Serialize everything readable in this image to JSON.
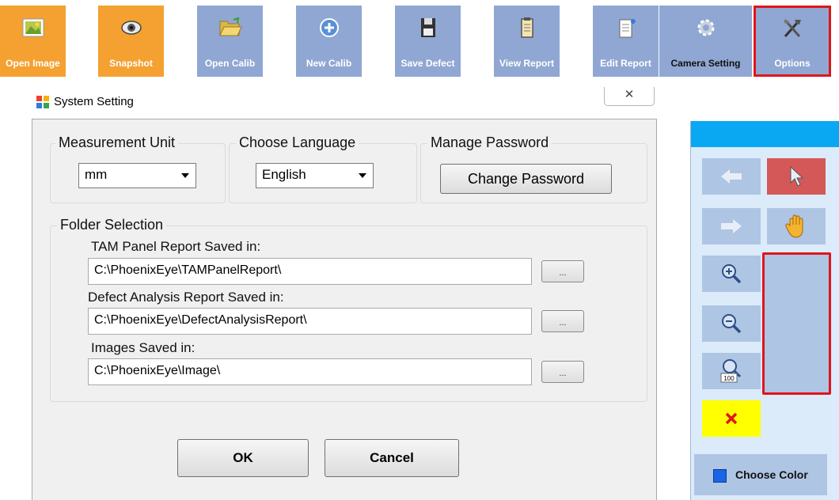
{
  "toolbar": {
    "buttons": [
      {
        "label": "Open Image",
        "icon": "image-icon"
      },
      {
        "label": "Snapshot",
        "icon": "eye-icon"
      },
      {
        "label": "Open Calib",
        "icon": "folder-open-icon"
      },
      {
        "label": "New Calib",
        "icon": "plus-circle-icon"
      },
      {
        "label": "Save Defect",
        "icon": "floppy-disk-icon"
      },
      {
        "label": "View Report",
        "icon": "clipboard-icon"
      },
      {
        "label": "Edit Report",
        "icon": "edit-document-icon"
      },
      {
        "label": "Camera Setting",
        "icon": "gear-icon"
      },
      {
        "label": "Options",
        "icon": "tools-icon"
      }
    ],
    "active_color": "#f4a131",
    "button_color": "#8fa7d2",
    "highlight_color": "#e0151a"
  },
  "dialog": {
    "title": "System Setting",
    "close_glyph": "✕",
    "measurement": {
      "label": "Measurement Unit",
      "value": "mm"
    },
    "language": {
      "label": "Choose Language",
      "value": "English"
    },
    "password": {
      "label": "Manage Password",
      "button": "Change Password"
    },
    "folders": {
      "label": "Folder Selection",
      "items": [
        {
          "label": "TAM Panel Report Saved in:",
          "path": "C:\\PhoenixEye\\TAMPanelReport\\",
          "browse": "..."
        },
        {
          "label": "Defect Analysis Report Saved in:",
          "path": "C:\\PhoenixEye\\DefectAnalysisReport\\",
          "browse": "..."
        },
        {
          "label": "Images Saved in:",
          "path": "C:\\PhoenixEye\\Image\\",
          "browse": "..."
        }
      ]
    },
    "ok_label": "OK",
    "cancel_label": "Cancel"
  },
  "tool_panel": {
    "header_color": "#0aa8f3",
    "tools": [
      "back-arrow-icon",
      "pointer-cursor-icon",
      "forward-arrow-icon",
      "hand-pan-icon",
      "zoom-in-icon",
      "line-tool-icon",
      "zoom-out-icon",
      "circle-tool-icon",
      "zoom-100-icon",
      "rectangle-tool-icon",
      "delete-x-icon"
    ],
    "choose_color_label": "Choose Color",
    "selected_color": "#1a64e6"
  }
}
